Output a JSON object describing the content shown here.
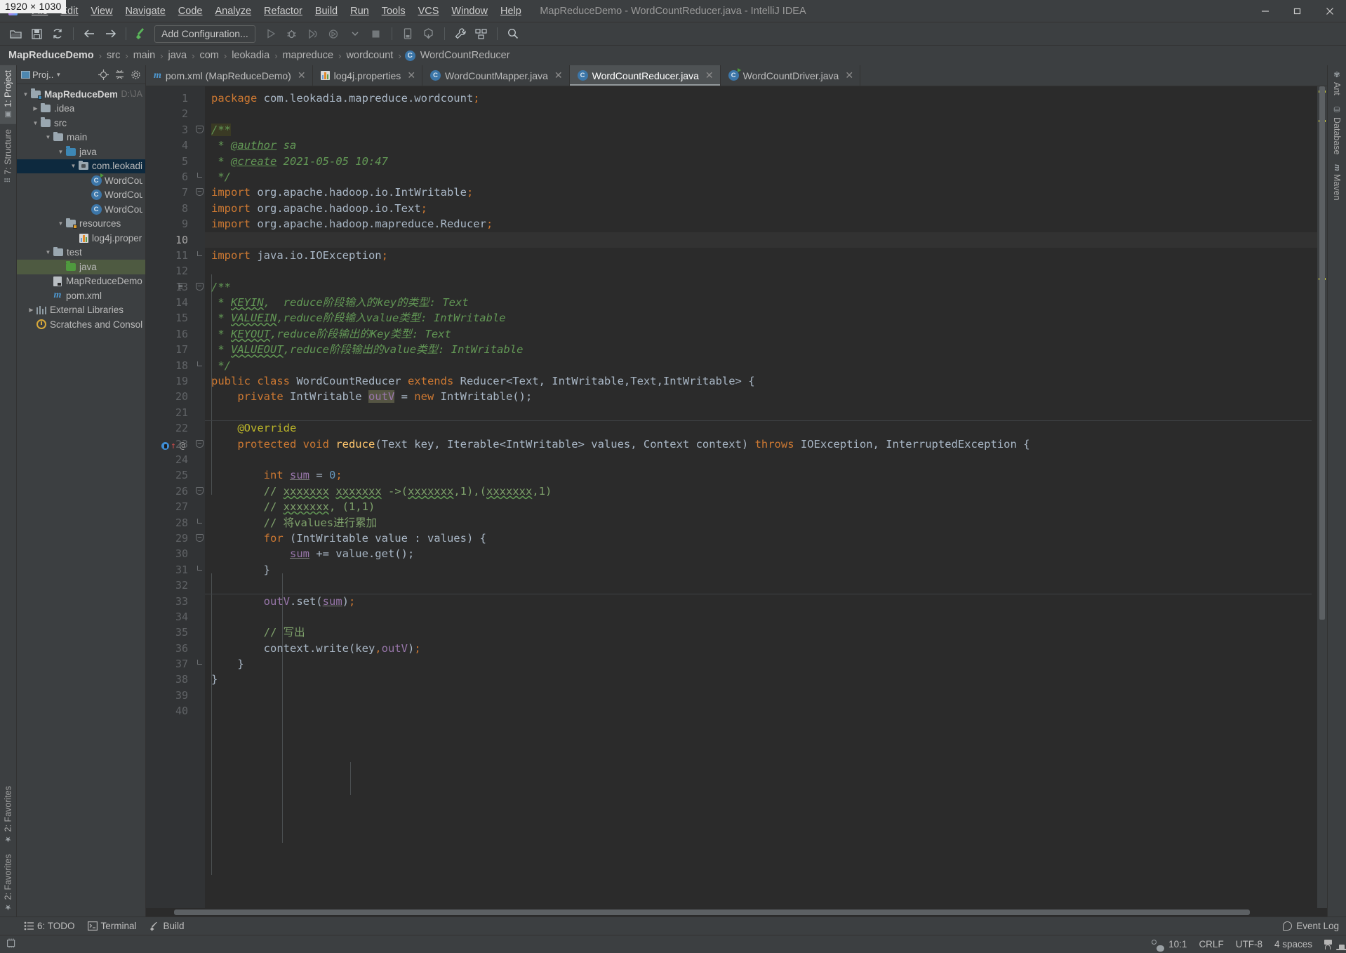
{
  "window": {
    "title": "MapReduceDemo - WordCountReducer.java - IntelliJ IDEA",
    "size_badge": "1920 × 1030"
  },
  "menu": [
    {
      "label": "File"
    },
    {
      "label": "Edit"
    },
    {
      "label": "View"
    },
    {
      "label": "Navigate"
    },
    {
      "label": "Code"
    },
    {
      "label": "Analyze"
    },
    {
      "label": "Refactor"
    },
    {
      "label": "Build"
    },
    {
      "label": "Run"
    },
    {
      "label": "Tools"
    },
    {
      "label": "VCS"
    },
    {
      "label": "Window"
    },
    {
      "label": "Help"
    }
  ],
  "window_controls": {
    "minimize": "—",
    "maximize": "❐",
    "close": "✕"
  },
  "toolbar": {
    "open_label": "open-project",
    "save_label": "save-all",
    "sync_label": "synchronize",
    "back_label": "back",
    "forward_label": "forward",
    "build_label": "build-project",
    "add_configuration": "Add Configuration...",
    "run_label": "run",
    "debug_label": "debug",
    "coverage_label": "run-with-coverage",
    "profile_label": "profile",
    "stop_label": "stop",
    "device_label": "device-manager",
    "sdk_label": "sdk-manager",
    "settings_label": "settings",
    "structure_label": "project-structure",
    "search_label": "search-everywhere"
  },
  "breadcrumb": {
    "items": [
      "MapReduceDemo",
      "src",
      "main",
      "java",
      "com",
      "leokadia",
      "mapreduce",
      "wordcount"
    ],
    "current_file": "WordCountReducer",
    "current_icon": "C"
  },
  "left_strip": [
    {
      "label": "1: Project",
      "icon": "project-icon",
      "selected": true
    },
    {
      "label": "7: Structure",
      "icon": "structure-icon",
      "selected": false
    },
    {
      "label": "2: Favorites",
      "icon": "star-icon",
      "selected": false
    }
  ],
  "left_strip_bottom": [
    {
      "label": "2: Favorites",
      "icon": "star-icon"
    }
  ],
  "right_strip": [
    {
      "label": "Ant",
      "icon": "ant-icon"
    },
    {
      "label": "Database",
      "icon": "database-icon"
    },
    {
      "label": "Maven",
      "icon": "maven-icon"
    }
  ],
  "project_panel": {
    "title": "Proj..",
    "locate_icon": "locate-icon",
    "collapse_icon": "collapse-all-icon",
    "settings_icon": "gear-icon",
    "tree": [
      {
        "label": "MapReduceDemo",
        "suffix": "D:\\JA",
        "depth": 0,
        "arrow": "▼",
        "icon": "module-folder",
        "bold": true,
        "state": "none"
      },
      {
        "label": ".idea",
        "depth": 1,
        "arrow": "▶",
        "icon": "folder",
        "state": "none"
      },
      {
        "label": "src",
        "depth": 1,
        "arrow": "▼",
        "icon": "folder",
        "state": "none"
      },
      {
        "label": "main",
        "depth": 2,
        "arrow": "▼",
        "icon": "folder",
        "state": "none"
      },
      {
        "label": "java",
        "depth": 3,
        "arrow": "▼",
        "icon": "folder-blue",
        "state": "none"
      },
      {
        "label": "com.leokadi",
        "depth": 4,
        "arrow": "▼",
        "icon": "package",
        "state": "selected-blue"
      },
      {
        "label": "WordCou",
        "depth": 5,
        "arrow": "",
        "icon": "class-runnable",
        "state": "none"
      },
      {
        "label": "WordCou",
        "depth": 5,
        "arrow": "",
        "icon": "class",
        "state": "none"
      },
      {
        "label": "WordCou",
        "depth": 5,
        "arrow": "",
        "icon": "class",
        "state": "none"
      },
      {
        "label": "resources",
        "depth": 3,
        "arrow": "▼",
        "icon": "folder-resources",
        "state": "none"
      },
      {
        "label": "log4j.proper",
        "depth": 4,
        "arrow": "",
        "icon": "properties",
        "state": "none"
      },
      {
        "label": "test",
        "depth": 2,
        "arrow": "▼",
        "icon": "folder",
        "state": "none"
      },
      {
        "label": "java",
        "depth": 3,
        "arrow": "",
        "icon": "folder-green",
        "state": "selected-green"
      },
      {
        "label": "MapReduceDemo.iml",
        "depth": 2,
        "arrow": "",
        "icon": "iml",
        "state": "none"
      },
      {
        "label": "pom.xml",
        "depth": 2,
        "arrow": "",
        "icon": "maven-m",
        "state": "none"
      },
      {
        "label": "External Libraries",
        "depth": 0,
        "arrow": "▶",
        "icon": "libraries",
        "state": "none"
      },
      {
        "label": "Scratches and Consoles",
        "depth": 0,
        "arrow": "",
        "icon": "scratches",
        "state": "none"
      }
    ]
  },
  "tabs": [
    {
      "label": "pom.xml (MapReduceDemo)",
      "icon": "maven-m",
      "active": false,
      "close": "✕"
    },
    {
      "label": "log4j.properties",
      "icon": "properties",
      "active": false,
      "close": "✕"
    },
    {
      "label": "WordCountMapper.java",
      "icon": "class",
      "active": false,
      "close": "✕"
    },
    {
      "label": "WordCountReducer.java",
      "icon": "class",
      "active": true,
      "close": "✕"
    },
    {
      "label": "WordCountDriver.java",
      "icon": "class-runnable",
      "active": false,
      "close": "✕"
    }
  ],
  "editor": {
    "total_lines": 40,
    "current_line": 10,
    "lines": [
      {
        "n": 1,
        "text": "package com.leokadia.mapreduce.wordcount;"
      },
      {
        "n": 2,
        "text": ""
      },
      {
        "n": 3,
        "text": "/**"
      },
      {
        "n": 4,
        "text": " * @author sa"
      },
      {
        "n": 5,
        "text": " * @create 2021-05-05 10:47"
      },
      {
        "n": 6,
        "text": " */"
      },
      {
        "n": 7,
        "text": "import org.apache.hadoop.io.IntWritable;"
      },
      {
        "n": 8,
        "text": "import org.apache.hadoop.io.Text;"
      },
      {
        "n": 9,
        "text": "import org.apache.hadoop.mapreduce.Reducer;"
      },
      {
        "n": 10,
        "text": ""
      },
      {
        "n": 11,
        "text": "import java.io.IOException;"
      },
      {
        "n": 12,
        "text": ""
      },
      {
        "n": 13,
        "text": "/**"
      },
      {
        "n": 14,
        "text": " * KEYIN,  reduce阶段输入的key的类型: Text"
      },
      {
        "n": 15,
        "text": " * VALUEIN,reduce阶段输入value类型: IntWritable"
      },
      {
        "n": 16,
        "text": " * KEYOUT,reduce阶段输出的Key类型: Text"
      },
      {
        "n": 17,
        "text": " * VALUEOUT,reduce阶段输出的value类型: IntWritable"
      },
      {
        "n": 18,
        "text": " */"
      },
      {
        "n": 19,
        "text": "public class WordCountReducer extends Reducer<Text, IntWritable,Text,IntWritable> {"
      },
      {
        "n": 20,
        "text": "    private IntWritable outV = new IntWritable();"
      },
      {
        "n": 21,
        "text": ""
      },
      {
        "n": 22,
        "text": "    @Override"
      },
      {
        "n": 23,
        "text": "    protected void reduce(Text key, Iterable<IntWritable> values, Context context) throws IOException, InterruptedException {"
      },
      {
        "n": 24,
        "text": ""
      },
      {
        "n": 25,
        "text": "        int sum = 0;"
      },
      {
        "n": 26,
        "text": "        // xxxxxxx xxxxxxx ->(xxxxxxx,1),(xxxxxxx,1)"
      },
      {
        "n": 27,
        "text": "        // xxxxxxx, (1,1)"
      },
      {
        "n": 28,
        "text": "        // 将values进行累加"
      },
      {
        "n": 29,
        "text": "        for (IntWritable value : values) {"
      },
      {
        "n": 30,
        "text": "            sum += value.get();"
      },
      {
        "n": 31,
        "text": "        }"
      },
      {
        "n": 32,
        "text": ""
      },
      {
        "n": 33,
        "text": "        outV.set(sum);"
      },
      {
        "n": 34,
        "text": ""
      },
      {
        "n": 35,
        "text": "        // 写出"
      },
      {
        "n": 36,
        "text": "        context.write(key,outV);"
      },
      {
        "n": 37,
        "text": "    }"
      },
      {
        "n": 38,
        "text": "}"
      },
      {
        "n": 39,
        "text": ""
      },
      {
        "n": 40,
        "text": ""
      }
    ]
  },
  "bottom_bar": [
    {
      "label": "6: TODO",
      "icon": "todo-icon"
    },
    {
      "label": "Terminal",
      "icon": "terminal-icon"
    },
    {
      "label": "Build",
      "icon": "build-icon"
    }
  ],
  "event_log": {
    "label": "Event Log",
    "icon": "balloon-icon"
  },
  "status_bar": {
    "inspection_icon": "inspections-icon",
    "caret": "10:1",
    "line_separator": "CRLF",
    "encoding": "UTF-8",
    "indent": "4 spaces",
    "lock_icon": "unlock-icon",
    "hat_icon": "hector-icon"
  },
  "colors": {
    "background": "#3c3f41",
    "editor_bg": "#2b2b2b",
    "gutter_bg": "#313335",
    "keyword": "#cc7832",
    "comment": "#629755",
    "number": "#6897bb",
    "field": "#9876aa",
    "annotation": "#bbb529",
    "method": "#ffc66d",
    "identifier": "#a9b7c6",
    "selection_blue": "#0d293e",
    "selection_green": "#4e5a41"
  }
}
